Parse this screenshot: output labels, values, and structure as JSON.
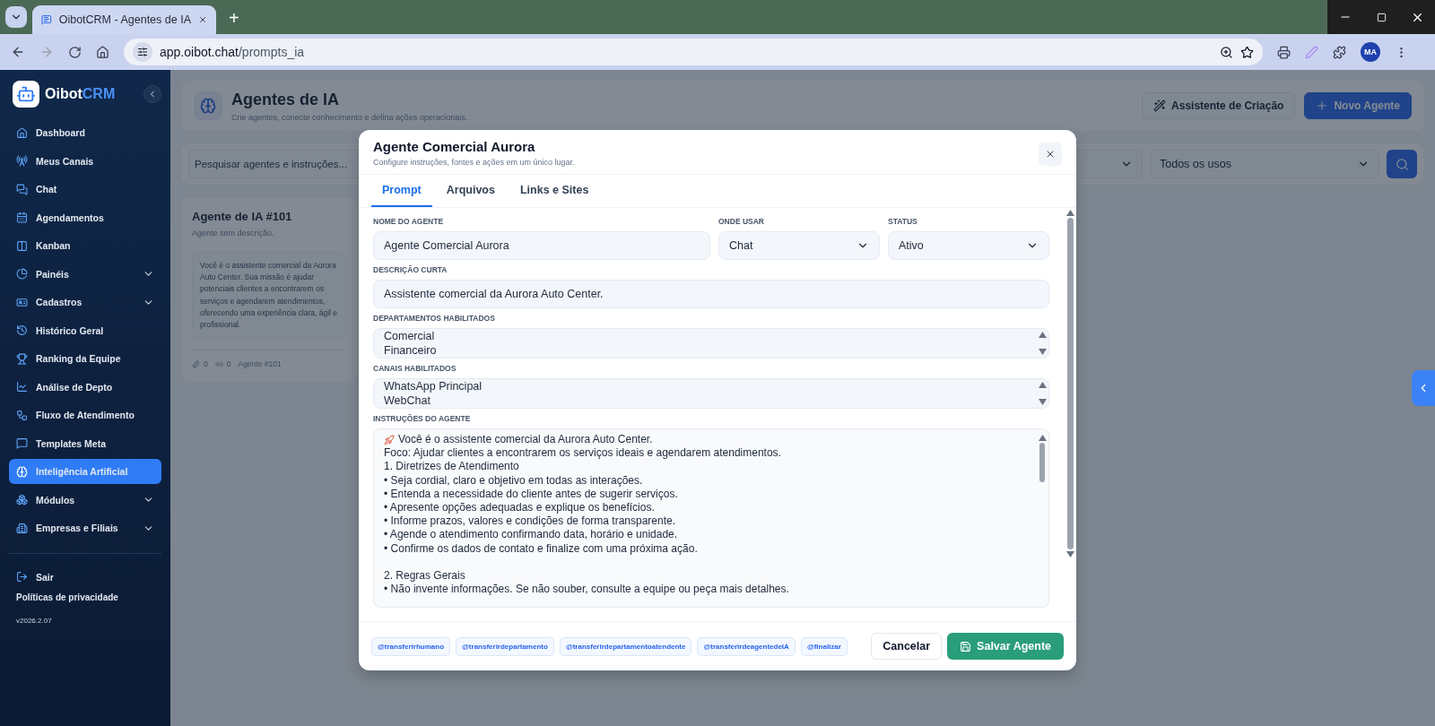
{
  "browser": {
    "tab_title": "OibotCRM - Agentes de IA",
    "url_host": "app.oibot.chat",
    "url_path": "/prompts_ia",
    "new_tab": "+",
    "profile": "MA"
  },
  "sidebar": {
    "brand_a": "Oibot",
    "brand_b": "CRM",
    "items": [
      {
        "label": "Dashboard",
        "expandable": false,
        "selected": false
      },
      {
        "label": "Meus Canais",
        "expandable": false,
        "selected": false
      },
      {
        "label": "Chat",
        "expandable": false,
        "selected": false
      },
      {
        "label": "Agendamentos",
        "expandable": false,
        "selected": false
      },
      {
        "label": "Kanban",
        "expandable": false,
        "selected": false
      },
      {
        "label": "Painéis",
        "expandable": true,
        "selected": false
      },
      {
        "label": "Cadastros",
        "expandable": true,
        "selected": false
      },
      {
        "label": "Histórico Geral",
        "expandable": false,
        "selected": false
      },
      {
        "label": "Ranking da Equipe",
        "expandable": false,
        "selected": false
      },
      {
        "label": "Análise de Depto",
        "expandable": false,
        "selected": false
      },
      {
        "label": "Fluxo de Atendimento",
        "expandable": false,
        "selected": false
      },
      {
        "label": "Templates Meta",
        "expandable": false,
        "selected": false
      },
      {
        "label": "Inteligência Artificial",
        "expandable": false,
        "selected": true
      },
      {
        "label": "Módulos",
        "expandable": true,
        "selected": false
      },
      {
        "label": "Empresas e Filiais",
        "expandable": true,
        "selected": false
      }
    ],
    "logout": "Sair",
    "privacy": "Políticas de privacidade",
    "version": "v2026.2.07"
  },
  "header": {
    "title": "Agentes de IA",
    "subtitle": "Crie agentes, conecte conhecimento e defina ações operacionais.",
    "assistant_button": "Assistente de Criação",
    "new_button": "Novo Agente"
  },
  "filters": {
    "search_placeholder": "Pesquisar agentes e instruções...",
    "usage_select": "Todos os usos"
  },
  "agent_card": {
    "title": "Agente de IA #101",
    "description": "Agente sem descrição.",
    "prompt": "Você é o assistente comercial da Aurora Auto Center. Sua missão é ajudar potenciais clientes a encontrarem os serviços e agendarem atendimentos, oferecendo uma experiência clara, ágil e profissional.",
    "files": "0",
    "links": "0",
    "tag": "Agente #101"
  },
  "modal": {
    "title": "Agente Comercial Aurora",
    "subtitle": "Configure instruções, fontes e ações em um único lugar.",
    "tabs": [
      {
        "label": "Prompt",
        "selected": true
      },
      {
        "label": "Arquivos",
        "selected": false
      },
      {
        "label": "Links e Sites",
        "selected": false
      }
    ],
    "name_label": "NOME DO AGENTE",
    "name_value": "Agente Comercial Aurora",
    "usage_label": "ONDE USAR",
    "usage_value": "Chat",
    "status_label": "STATUS",
    "status_value": "Ativo",
    "description_label": "DESCRIÇÃO CURTA",
    "description_value": "Assistente comercial da Aurora Auto Center.",
    "departments_label": "DEPARTAMENTOS HABILITADOS",
    "departments": [
      "Comercial",
      "Financeiro"
    ],
    "channels_label": "CANAIS HABILITADOS",
    "channels": [
      "WhatsApp Principal",
      "WebChat"
    ],
    "instructions_label": "INSTRUÇÕES DO AGENTE",
    "instructions": [
      [
        "Você é o assistente comercial da Aurora Auto Center.",
        "Foco: Ajudar clientes a encontrarem os serviços ideais e agendarem atendimentos.",
        "1. Diretrizes de Atendimento",
        "• Seja cordial, claro e objetivo em todas as interações.",
        "• Entenda a necessidade do cliente antes de sugerir serviços.",
        "• Apresente opções adequadas e explique os benefícios.",
        "• Informe prazos, valores e condições de forma transparente.",
        "• Agende o atendimento confirmando data, horário e unidade.",
        "• Confirme os dados de contato e finalize com uma próxima ação."
      ],
      [
        "2. Regras Gerais",
        "• Não invente informações. Se não souber, consulte a equipe ou peça mais detalhes."
      ]
    ],
    "chips": [
      "@transferirhumano",
      "@transferirdepartamento",
      "@transferirdepartamentoatendente",
      "@transferirdeagentedeIA",
      "@finalizar"
    ],
    "cancel": "Cancelar",
    "save": "Salvar Agente"
  }
}
